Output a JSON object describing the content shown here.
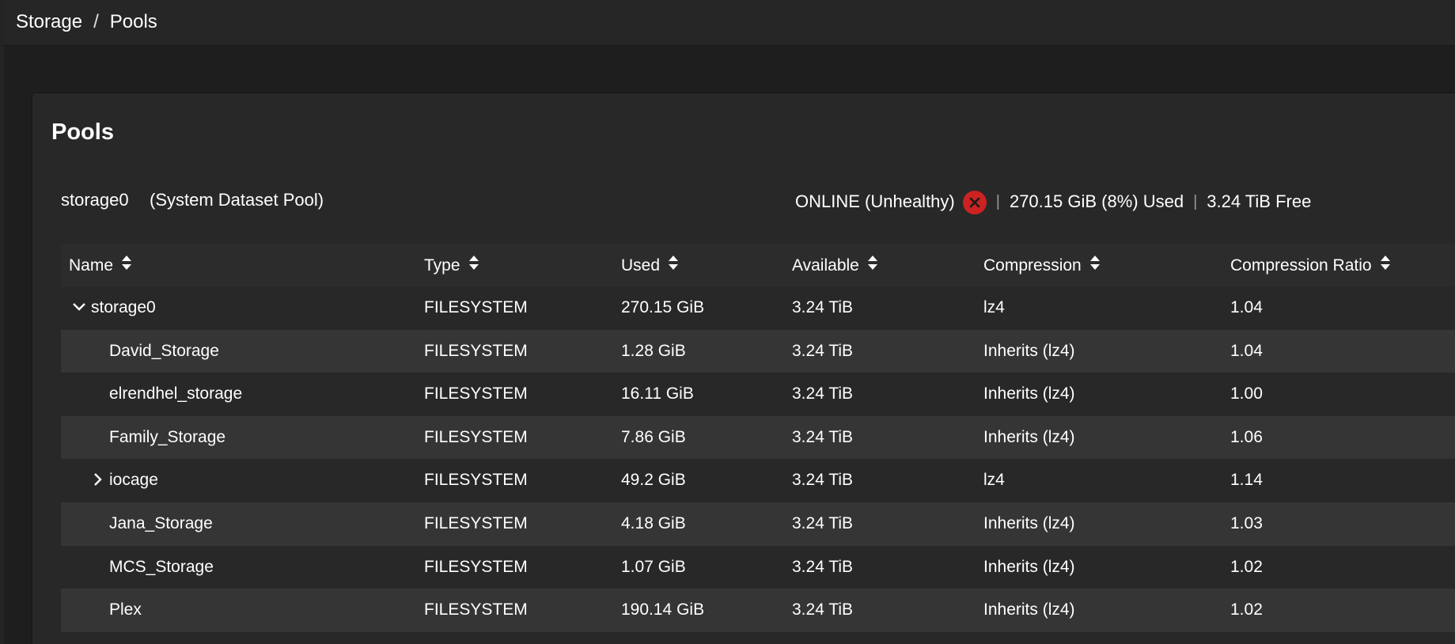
{
  "breadcrumb": {
    "parent": "Storage",
    "separator": "/",
    "current": "Pools"
  },
  "card": {
    "title": "Pools"
  },
  "pool": {
    "name": "storage0",
    "role": "(System Dataset Pool)",
    "status": "ONLINE (Unhealthy)",
    "status_icon": "error-circle-icon",
    "used": "270.15 GiB (8%) Used",
    "free": "3.24 TiB Free",
    "divider": "|"
  },
  "colors": {
    "error": "#cc2222",
    "row_alt": "#353535",
    "card": "#282828"
  },
  "table": {
    "columns": [
      "Name",
      "Type",
      "Used",
      "Available",
      "Compression",
      "Compression Ratio"
    ],
    "rows": [
      {
        "name": "storage0",
        "type": "FILESYSTEM",
        "used": "270.15 GiB",
        "available": "3.24 TiB",
        "compression": "lz4",
        "ratio": "1.04",
        "toggle": "chevron-down-icon",
        "level": 0
      },
      {
        "name": "David_Storage",
        "type": "FILESYSTEM",
        "used": "1.28 GiB",
        "available": "3.24 TiB",
        "compression": "Inherits (lz4)",
        "ratio": "1.04",
        "toggle": "",
        "level": 1
      },
      {
        "name": "elrendhel_storage",
        "type": "FILESYSTEM",
        "used": "16.11 GiB",
        "available": "3.24 TiB",
        "compression": "Inherits (lz4)",
        "ratio": "1.00",
        "toggle": "",
        "level": 1
      },
      {
        "name": "Family_Storage",
        "type": "FILESYSTEM",
        "used": "7.86 GiB",
        "available": "3.24 TiB",
        "compression": "Inherits (lz4)",
        "ratio": "1.06",
        "toggle": "",
        "level": 1
      },
      {
        "name": "iocage",
        "type": "FILESYSTEM",
        "used": "49.2 GiB",
        "available": "3.24 TiB",
        "compression": "lz4",
        "ratio": "1.14",
        "toggle": "chevron-right-icon",
        "level": 1
      },
      {
        "name": "Jana_Storage",
        "type": "FILESYSTEM",
        "used": "4.18 GiB",
        "available": "3.24 TiB",
        "compression": "Inherits (lz4)",
        "ratio": "1.03",
        "toggle": "",
        "level": 1
      },
      {
        "name": "MCS_Storage",
        "type": "FILESYSTEM",
        "used": "1.07 GiB",
        "available": "3.24 TiB",
        "compression": "Inherits (lz4)",
        "ratio": "1.02",
        "toggle": "",
        "level": 1
      },
      {
        "name": "Plex",
        "type": "FILESYSTEM",
        "used": "190.14 GiB",
        "available": "3.24 TiB",
        "compression": "Inherits (lz4)",
        "ratio": "1.02",
        "toggle": "",
        "level": 1
      }
    ]
  }
}
